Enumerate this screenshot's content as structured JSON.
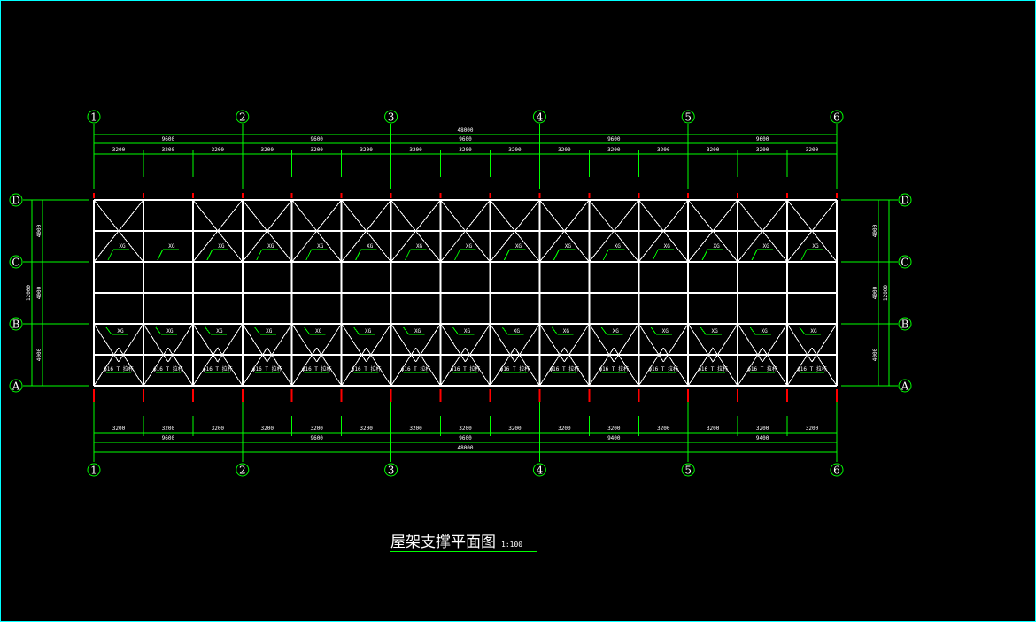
{
  "drawing": {
    "title": "屋架支撑平面图",
    "scale": "1:100",
    "column_axes": [
      "1",
      "2",
      "3",
      "4",
      "5",
      "6"
    ],
    "row_axes": [
      "D",
      "C",
      "B",
      "A"
    ],
    "top_dimensions": {
      "overall": "48000",
      "bays": [
        "9600",
        "9600",
        "9600",
        "9600",
        "9600"
      ],
      "sub_bays": [
        "3200",
        "3200",
        "3200",
        "3200",
        "3200",
        "3200",
        "3200",
        "3200",
        "3200",
        "3200",
        "3200",
        "3200",
        "3200",
        "3200",
        "3200"
      ]
    },
    "bottom_dimensions": {
      "overall": "48000",
      "bays": [
        "9600",
        "9600",
        "9600",
        "9400",
        "9400"
      ],
      "sub_bays": [
        "3200",
        "3200",
        "3200",
        "3200",
        "3200",
        "3200",
        "3200",
        "3200",
        "3200",
        "3200",
        "3200",
        "3200",
        "3200",
        "3200",
        "3200"
      ]
    },
    "left_dimensions": {
      "overall": "12000",
      "spans": [
        "4000",
        "4000",
        "4000"
      ]
    },
    "right_dimensions": {
      "overall": "12000",
      "spans": [
        "4000",
        "4000",
        "4000"
      ]
    },
    "member_labels": {
      "purlin_brace": "XG",
      "bottom_brace": "ϕ16 T 拉杆"
    },
    "colors": {
      "background": "#000000",
      "frame": "#00ffff",
      "dimension": "#00ff00",
      "structure": "#ffffff",
      "column_mark": "#ff0000",
      "text": "#ffffff"
    }
  }
}
